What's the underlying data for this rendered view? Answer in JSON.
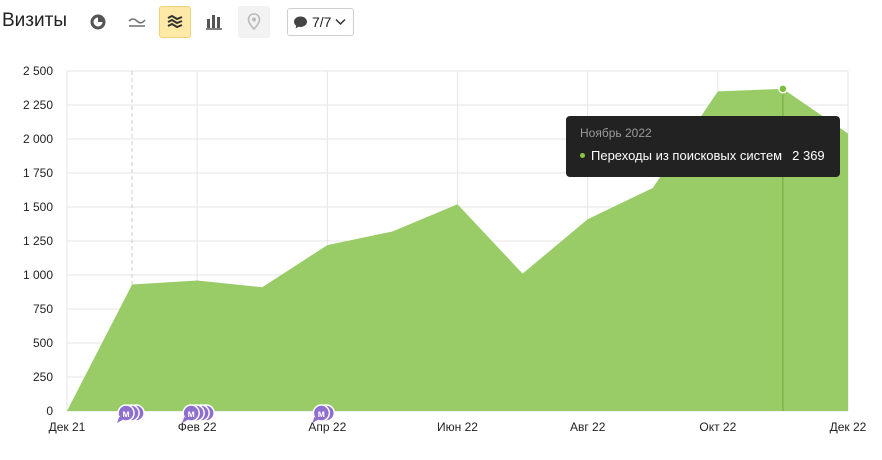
{
  "header": {
    "title": "Визиты",
    "counter_label": "7/7"
  },
  "toolbar_icons": [
    "pie-chart-icon",
    "line-chart-icon",
    "area-chart-icon",
    "bar-chart-icon",
    "map-pin-icon",
    "comment-icon",
    "chevron-down-icon"
  ],
  "colors": {
    "area": "#99cc66",
    "grid": "#e6e6e6",
    "active_button": "#ffe9a6",
    "tooltip_bg": "#222222",
    "marker": "#8e6fd0"
  },
  "tooltip": {
    "title": "Ноябрь 2022",
    "series_name": "Переходы из поисковых систем",
    "value": "2 369"
  },
  "markers": [
    {
      "x": "Янв 22",
      "label": "м",
      "count": 3
    },
    {
      "x": "Фев 22",
      "label": "м",
      "count": 4
    },
    {
      "x": "Апр 22",
      "label": "м",
      "count": 2
    }
  ],
  "chart_data": {
    "type": "area",
    "title": "",
    "xlabel": "",
    "ylabel": "",
    "categories": [
      "Дек 21",
      "Янв 22",
      "Фев 22",
      "Мар 22",
      "Апр 22",
      "Май 22",
      "Июн 22",
      "Июл 22",
      "Авг 22",
      "Сен 22",
      "Окт 22",
      "Ноя 22",
      "Дек 22"
    ],
    "x_tick_labels": [
      "Дек 21",
      "Фев 22",
      "Апр 22",
      "Июн 22",
      "Авг 22",
      "Окт 22",
      "Дек 22"
    ],
    "y_ticks": [
      0,
      250,
      500,
      750,
      1000,
      1250,
      1500,
      1750,
      2000,
      2250,
      2500
    ],
    "y_tick_labels": [
      "0",
      "250",
      "500",
      "750",
      "1 000",
      "1 250",
      "1 500",
      "1 750",
      "2 000",
      "2 250",
      "2 500"
    ],
    "ylim": [
      0,
      2500
    ],
    "grid": true,
    "series": [
      {
        "name": "Переходы из поисковых систем",
        "values": [
          0,
          930,
          960,
          910,
          1220,
          1320,
          1520,
          1010,
          1410,
          1640,
          2350,
          2369,
          2040
        ]
      }
    ],
    "highlight": {
      "category": "Ноя 22",
      "value": 2369
    }
  }
}
